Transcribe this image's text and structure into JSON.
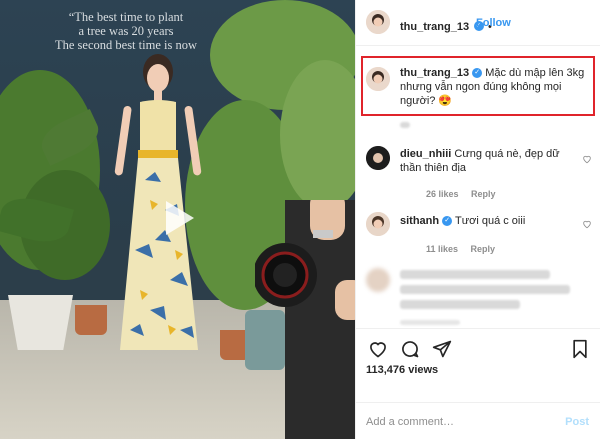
{
  "photo": {
    "quote_lines": [
      "“The best time to plant",
      "a tree was 20 years",
      "The second best time is now"
    ]
  },
  "header": {
    "username": "thu_trang_13",
    "follow_label": "Follow"
  },
  "caption": {
    "username": "thu_trang_13",
    "text": "Mặc dù mập lên 3kg nhưng vẫn ngon đúng không mọi người? 😍"
  },
  "comments": [
    {
      "username": "dieu_nhiii",
      "text": "Cưng quá nè, đẹp dữ thần thiên địa",
      "likes": "26 likes",
      "reply": "Reply"
    },
    {
      "username": "sithanh",
      "text": "Tươi quá c oiii",
      "likes": "11 likes",
      "reply": "Reply"
    }
  ],
  "stats": {
    "views": "113,476 views"
  },
  "add_comment": {
    "placeholder": "Add a comment…",
    "post_label": "Post"
  },
  "colors": {
    "accent": "#3897f0",
    "highlight": "#e0242b"
  }
}
